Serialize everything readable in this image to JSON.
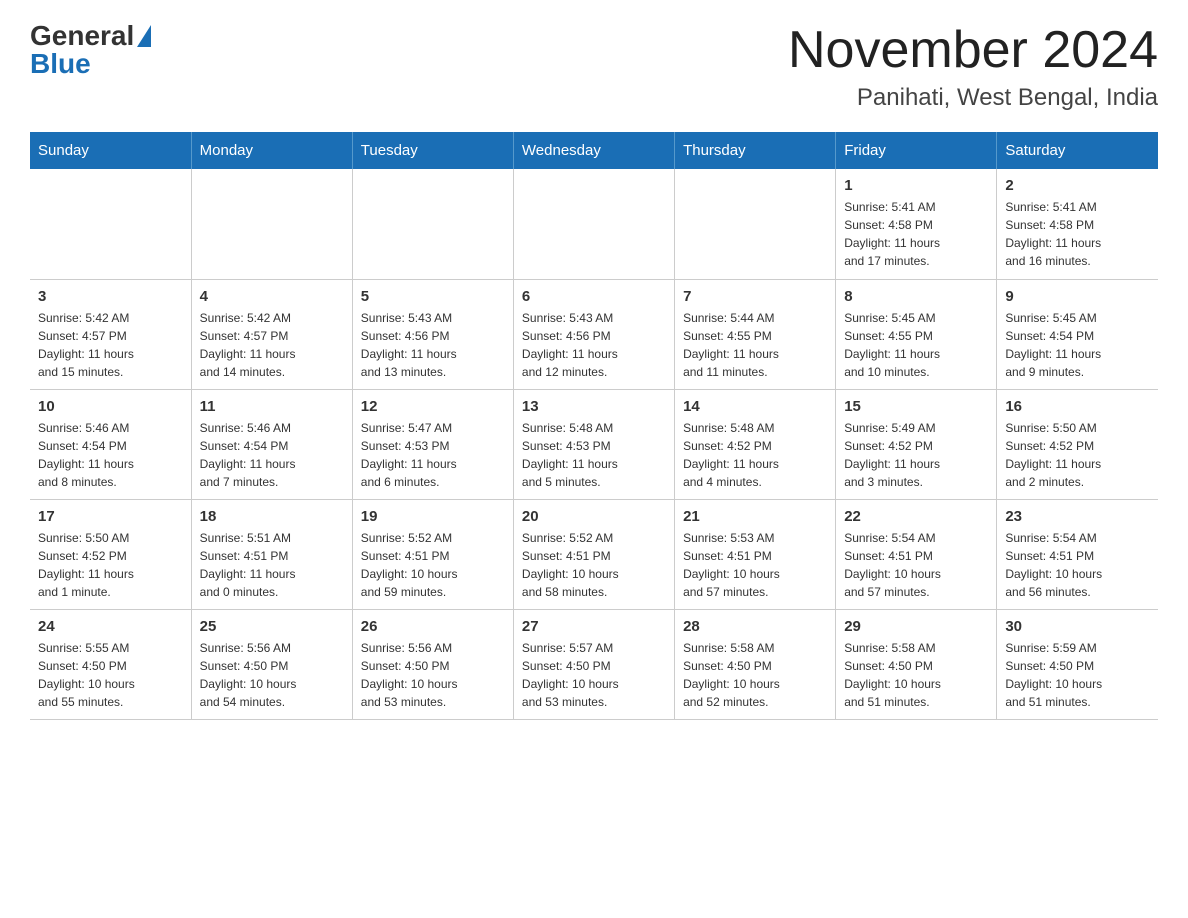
{
  "header": {
    "logo_general": "General",
    "logo_blue": "Blue",
    "month_title": "November 2024",
    "location": "Panihati, West Bengal, India"
  },
  "weekdays": [
    "Sunday",
    "Monday",
    "Tuesday",
    "Wednesday",
    "Thursday",
    "Friday",
    "Saturday"
  ],
  "weeks": [
    [
      {
        "day": "",
        "info": ""
      },
      {
        "day": "",
        "info": ""
      },
      {
        "day": "",
        "info": ""
      },
      {
        "day": "",
        "info": ""
      },
      {
        "day": "",
        "info": ""
      },
      {
        "day": "1",
        "info": "Sunrise: 5:41 AM\nSunset: 4:58 PM\nDaylight: 11 hours\nand 17 minutes."
      },
      {
        "day": "2",
        "info": "Sunrise: 5:41 AM\nSunset: 4:58 PM\nDaylight: 11 hours\nand 16 minutes."
      }
    ],
    [
      {
        "day": "3",
        "info": "Sunrise: 5:42 AM\nSunset: 4:57 PM\nDaylight: 11 hours\nand 15 minutes."
      },
      {
        "day": "4",
        "info": "Sunrise: 5:42 AM\nSunset: 4:57 PM\nDaylight: 11 hours\nand 14 minutes."
      },
      {
        "day": "5",
        "info": "Sunrise: 5:43 AM\nSunset: 4:56 PM\nDaylight: 11 hours\nand 13 minutes."
      },
      {
        "day": "6",
        "info": "Sunrise: 5:43 AM\nSunset: 4:56 PM\nDaylight: 11 hours\nand 12 minutes."
      },
      {
        "day": "7",
        "info": "Sunrise: 5:44 AM\nSunset: 4:55 PM\nDaylight: 11 hours\nand 11 minutes."
      },
      {
        "day": "8",
        "info": "Sunrise: 5:45 AM\nSunset: 4:55 PM\nDaylight: 11 hours\nand 10 minutes."
      },
      {
        "day": "9",
        "info": "Sunrise: 5:45 AM\nSunset: 4:54 PM\nDaylight: 11 hours\nand 9 minutes."
      }
    ],
    [
      {
        "day": "10",
        "info": "Sunrise: 5:46 AM\nSunset: 4:54 PM\nDaylight: 11 hours\nand 8 minutes."
      },
      {
        "day": "11",
        "info": "Sunrise: 5:46 AM\nSunset: 4:54 PM\nDaylight: 11 hours\nand 7 minutes."
      },
      {
        "day": "12",
        "info": "Sunrise: 5:47 AM\nSunset: 4:53 PM\nDaylight: 11 hours\nand 6 minutes."
      },
      {
        "day": "13",
        "info": "Sunrise: 5:48 AM\nSunset: 4:53 PM\nDaylight: 11 hours\nand 5 minutes."
      },
      {
        "day": "14",
        "info": "Sunrise: 5:48 AM\nSunset: 4:52 PM\nDaylight: 11 hours\nand 4 minutes."
      },
      {
        "day": "15",
        "info": "Sunrise: 5:49 AM\nSunset: 4:52 PM\nDaylight: 11 hours\nand 3 minutes."
      },
      {
        "day": "16",
        "info": "Sunrise: 5:50 AM\nSunset: 4:52 PM\nDaylight: 11 hours\nand 2 minutes."
      }
    ],
    [
      {
        "day": "17",
        "info": "Sunrise: 5:50 AM\nSunset: 4:52 PM\nDaylight: 11 hours\nand 1 minute."
      },
      {
        "day": "18",
        "info": "Sunrise: 5:51 AM\nSunset: 4:51 PM\nDaylight: 11 hours\nand 0 minutes."
      },
      {
        "day": "19",
        "info": "Sunrise: 5:52 AM\nSunset: 4:51 PM\nDaylight: 10 hours\nand 59 minutes."
      },
      {
        "day": "20",
        "info": "Sunrise: 5:52 AM\nSunset: 4:51 PM\nDaylight: 10 hours\nand 58 minutes."
      },
      {
        "day": "21",
        "info": "Sunrise: 5:53 AM\nSunset: 4:51 PM\nDaylight: 10 hours\nand 57 minutes."
      },
      {
        "day": "22",
        "info": "Sunrise: 5:54 AM\nSunset: 4:51 PM\nDaylight: 10 hours\nand 57 minutes."
      },
      {
        "day": "23",
        "info": "Sunrise: 5:54 AM\nSunset: 4:51 PM\nDaylight: 10 hours\nand 56 minutes."
      }
    ],
    [
      {
        "day": "24",
        "info": "Sunrise: 5:55 AM\nSunset: 4:50 PM\nDaylight: 10 hours\nand 55 minutes."
      },
      {
        "day": "25",
        "info": "Sunrise: 5:56 AM\nSunset: 4:50 PM\nDaylight: 10 hours\nand 54 minutes."
      },
      {
        "day": "26",
        "info": "Sunrise: 5:56 AM\nSunset: 4:50 PM\nDaylight: 10 hours\nand 53 minutes."
      },
      {
        "day": "27",
        "info": "Sunrise: 5:57 AM\nSunset: 4:50 PM\nDaylight: 10 hours\nand 53 minutes."
      },
      {
        "day": "28",
        "info": "Sunrise: 5:58 AM\nSunset: 4:50 PM\nDaylight: 10 hours\nand 52 minutes."
      },
      {
        "day": "29",
        "info": "Sunrise: 5:58 AM\nSunset: 4:50 PM\nDaylight: 10 hours\nand 51 minutes."
      },
      {
        "day": "30",
        "info": "Sunrise: 5:59 AM\nSunset: 4:50 PM\nDaylight: 10 hours\nand 51 minutes."
      }
    ]
  ]
}
